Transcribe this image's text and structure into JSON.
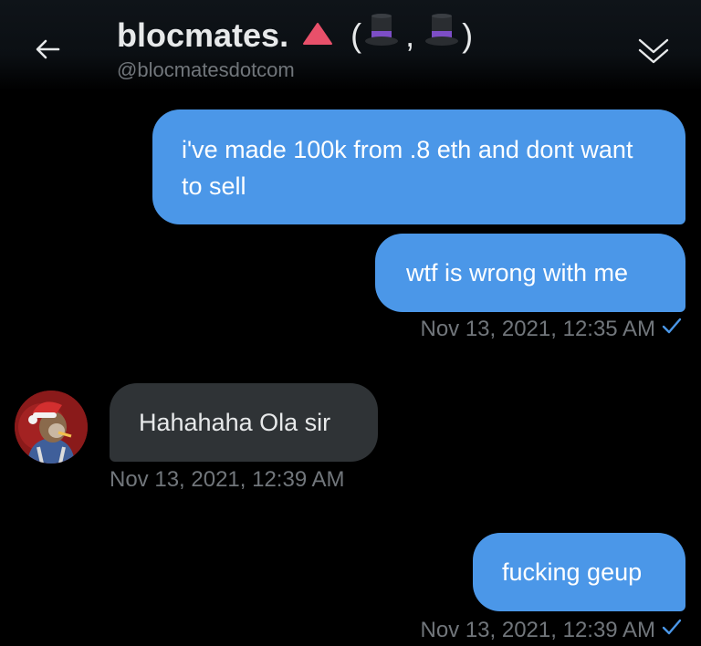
{
  "header": {
    "title": "blocmates.",
    "title_suffix_open": "(",
    "title_suffix_sep": ",",
    "title_suffix_close": ")",
    "handle": "@blocmatesdotcom",
    "back_icon": "arrow-left-icon",
    "collapse_icon": "double-chevron-down-icon",
    "title_emoji": [
      "red-triangle-icon",
      "top-hat-icon",
      "top-hat-icon"
    ]
  },
  "messages": [
    {
      "direction": "outgoing",
      "text": "i've made 100k from .8 eth and dont want to sell"
    },
    {
      "direction": "outgoing",
      "text": "wtf is wrong with me",
      "timestamp": "Nov 13, 2021, 12:35 AM",
      "status_icon": "check-icon"
    },
    {
      "direction": "incoming",
      "text": "Hahahaha Ola sir",
      "timestamp": "Nov 13, 2021, 12:39 AM",
      "avatar_icon": "avatar-icon"
    },
    {
      "direction": "outgoing",
      "text": "fucking geup",
      "timestamp": "Nov 13, 2021, 12:39 AM",
      "status_icon": "check-icon"
    }
  ],
  "colors": {
    "background": "#000000",
    "outgoing_bubble": "#4b97e8",
    "incoming_bubble": "#2f3336",
    "muted_text": "#71767b",
    "check": "#4b97e8"
  }
}
